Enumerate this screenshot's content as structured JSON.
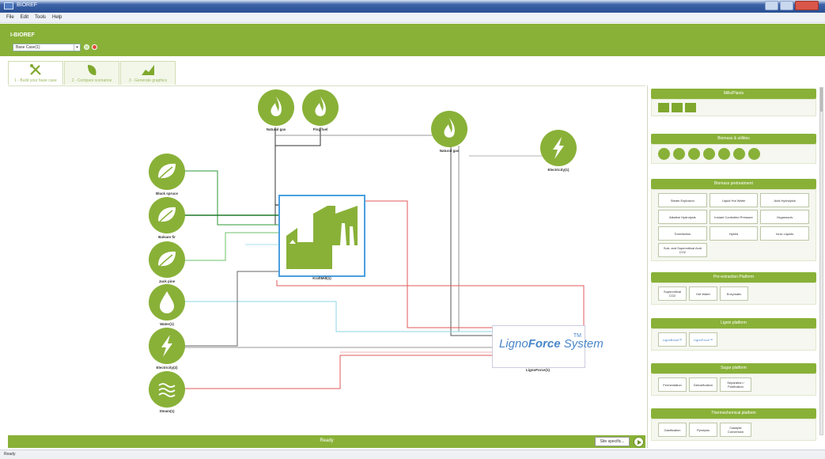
{
  "window": {
    "title": "BIOREF"
  },
  "menu": [
    "File",
    "Edit",
    "Tools",
    "Help"
  ],
  "header": {
    "app_title": "I-BIOREF",
    "case_value": "Base Case(1)"
  },
  "tabs": [
    {
      "label": "1 - Build your base case",
      "icon": "tools-icon"
    },
    {
      "label": "2 - Compare scenarios",
      "icon": "leaf-icon"
    },
    {
      "label": "3 - Generate graphics",
      "icon": "chart-icon"
    }
  ],
  "nodes": {
    "natural_gas_top": "Natural gas",
    "flog_fuel": "Flog fuel",
    "natural_gas_mid": "Natural gas",
    "electricity_out": "Electricity(1)",
    "black_spruce": "Black spruce",
    "balsam_fir": "Balsam fir",
    "jack_pine": "Jack pine",
    "water": "Water(1)",
    "electricity_in": "Electricity(2)",
    "steam": "Steam(1)",
    "kraft_mill": "KraftMill(1)",
    "ligno_force": "LignoForce(1)"
  },
  "ligno_brand": {
    "part1": "Ligno",
    "part2": "Force",
    "part3": " System",
    "tm": "TM"
  },
  "bottom": {
    "status": "Ready",
    "site_button": "Site specific..."
  },
  "statusbar": "Ready",
  "panel": {
    "mills": {
      "title": "Mills/Plants"
    },
    "biomass": {
      "title": "Biomass & utilities"
    },
    "pretreatment": {
      "title": "Biomass pretreatment",
      "buttons": [
        "Steam Explosion",
        "Liquid Hot Water",
        "Acid Hydrolysis",
        "Alkaline Hydrolysis",
        "Instant Controlled Pressure",
        "Organosolv",
        "Torrefaction",
        "Hybrid",
        "Ionic Liquids",
        "Sub- and Supercritical Acid CO2"
      ]
    },
    "preextraction": {
      "title": "Pre-extraction Platform",
      "buttons": [
        "Supercritical CO2",
        "Hot Water",
        "Enzymatic"
      ]
    },
    "lignin": {
      "title": "Lignin platform",
      "buttons": [
        "LignoBoost™",
        "LignoForce™"
      ]
    },
    "sugar": {
      "title": "Sugar platform",
      "buttons": [
        "Fermentation",
        "Detoxification",
        "Separation / Purification"
      ]
    },
    "thermo": {
      "title": "Thermochemical platform",
      "buttons": [
        "Gasification",
        "Pyrolysis",
        "Catalytic Conversion"
      ]
    }
  },
  "colors": {
    "accent": "#89b138",
    "select_border": "#4a9fe0",
    "flow_red": "#e05a5a",
    "flow_green": "#2f9a3a",
    "flow_cyan": "#8cd6e6"
  }
}
